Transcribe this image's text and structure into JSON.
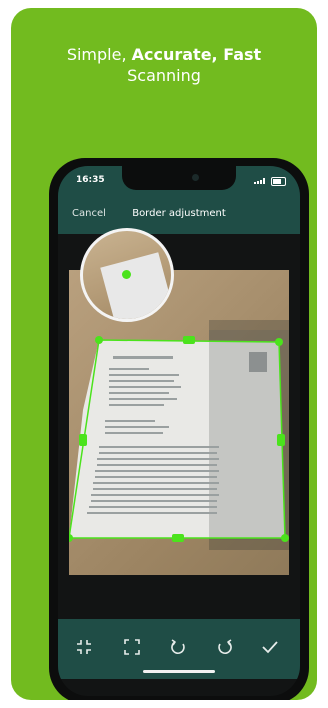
{
  "headline": {
    "line1_regular": "Simple, ",
    "line1_bold": "Accurate, Fast",
    "line2": "Scanning"
  },
  "colors": {
    "background_green": "#72bb1f",
    "app_bar": "#1f4d46",
    "handle_green": "#4be31c"
  },
  "status_bar": {
    "time": "16:35",
    "icons": [
      "signal-icon",
      "battery-icon"
    ]
  },
  "navigation": {
    "cancel_label": "Cancel",
    "title": "Border adjustment"
  },
  "toolbar": {
    "tools": [
      {
        "name": "shrink-crop-icon"
      },
      {
        "name": "full-frame-icon"
      },
      {
        "name": "rotate-left-icon"
      },
      {
        "name": "rotate-right-icon"
      },
      {
        "name": "confirm-checkmark-icon"
      }
    ]
  }
}
